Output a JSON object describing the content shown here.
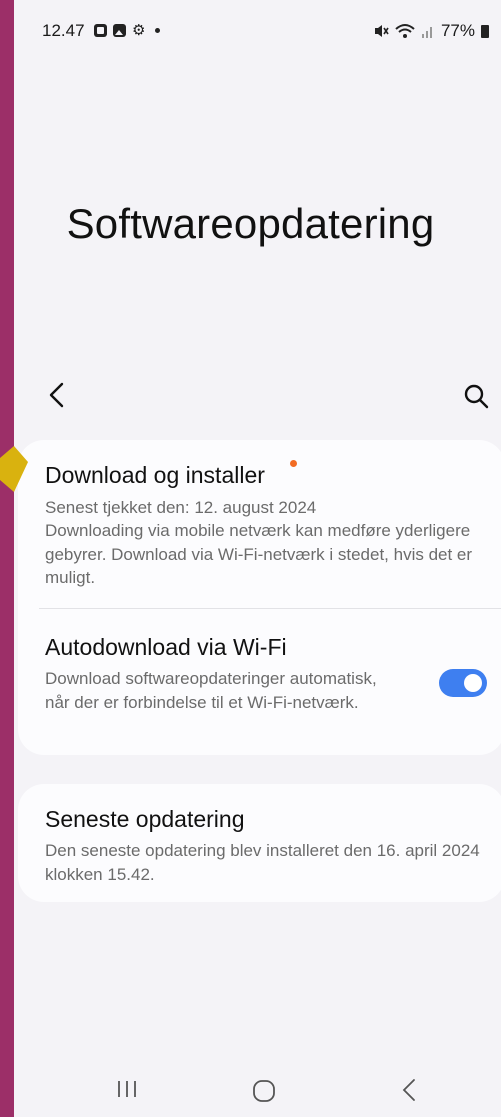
{
  "status_bar": {
    "time": "12.47",
    "battery": "77%"
  },
  "page": {
    "title": "Softwareopdatering"
  },
  "items": [
    {
      "title": "Download og installer",
      "subtitle_line1": "Senest tjekket den: 12. august 2024",
      "subtitle_line2": "Downloading via mobile netværk kan medføre yderligere gebyrer. Download via Wi-Fi-netværk i stedet, hvis det er muligt.",
      "has_badge": true
    },
    {
      "title": "Autodownload via Wi-Fi",
      "subtitle": "Download softwareopdateringer automatisk, når der er forbindelse til et Wi-Fi-netværk.",
      "toggle_on": true
    },
    {
      "title": "Seneste opdatering",
      "subtitle": "Den seneste opdatering blev installeret den 16. april 2024 klokken 15.42."
    }
  ],
  "colors": {
    "frame": "#9c2f68",
    "background": "#f4f3f7",
    "toggle_accent": "#3e7ff0",
    "badge": "#f26b22",
    "pointer_arrow": "#d9b20f"
  }
}
